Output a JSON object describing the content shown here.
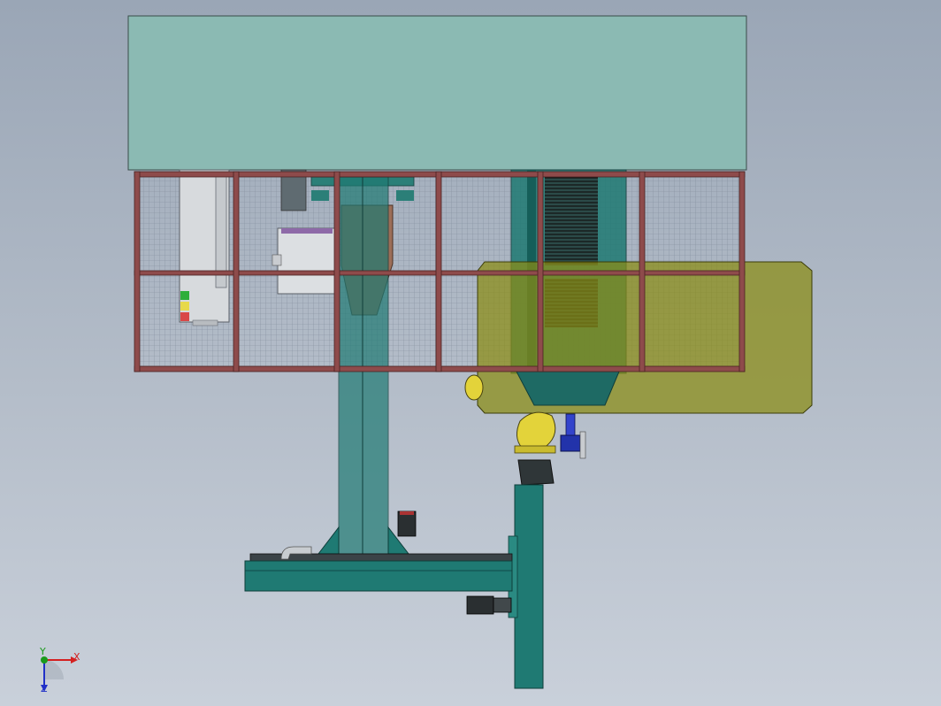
{
  "triad": {
    "x_label": "X",
    "y_label": "Y",
    "z_label": "Z"
  },
  "colors": {
    "background_top": "#9aa6b6",
    "background_bottom": "#c9d0da",
    "roof_panel": "#8bbab3",
    "fence_frame": "#8e4b4b",
    "mesh": "#8f9aa8",
    "column_teal": "#1f7a73",
    "column_dark": "#155e59",
    "olive_envelope": "#8a8c12",
    "robot_yellow": "#e3d33a",
    "motor_blue": "#2233aa",
    "axis_x": "#d42020",
    "axis_y": "#1a9a1a",
    "axis_z": "#2030c8"
  }
}
